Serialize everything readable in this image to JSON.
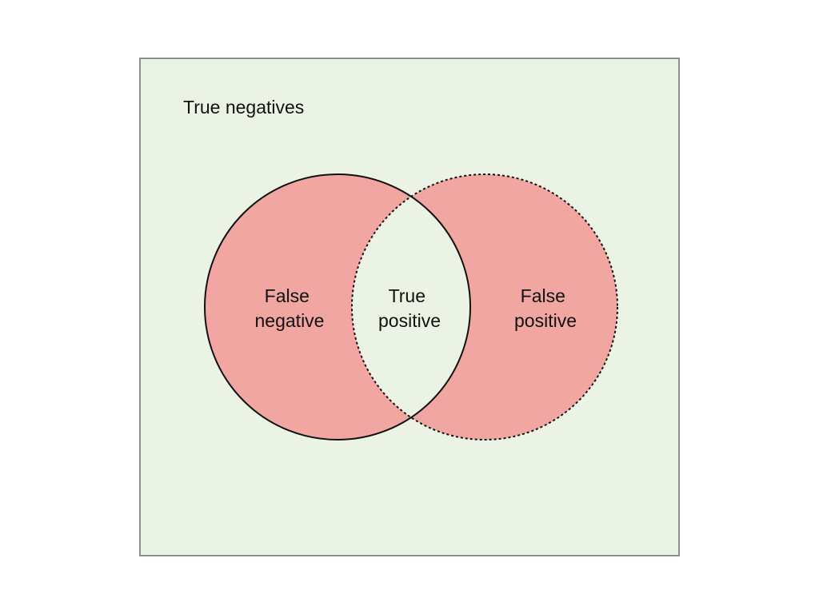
{
  "colors": {
    "background": "#ffffff",
    "universe_fill": "#ebf4e4",
    "universe_border": "#8f8f8f",
    "error_fill": "#f2a6a2",
    "outline": "#111111",
    "text": "#111111"
  },
  "labels": {
    "true_negatives": "True negatives",
    "false_negative": [
      "False",
      "negative"
    ],
    "true_positive": [
      "True",
      "positive"
    ],
    "false_positive": [
      "False",
      "positive"
    ]
  },
  "outline_styles": {
    "left_circle": "solid",
    "right_circle": "dotted"
  }
}
